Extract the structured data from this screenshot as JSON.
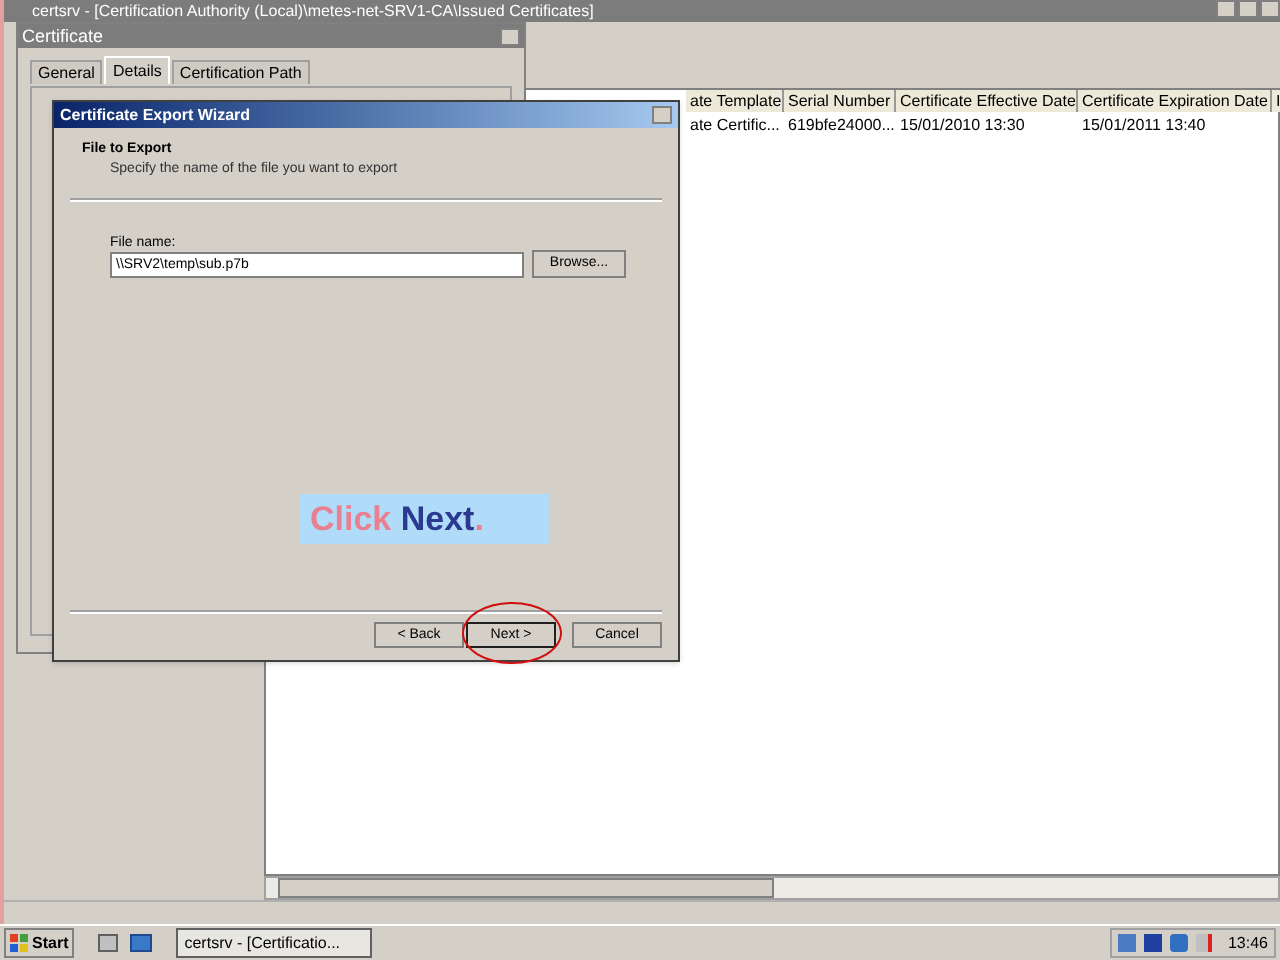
{
  "main_window": {
    "title": "certsrv - [Certification Authority (Local)\\metes-net-SRV1-CA\\Issued Certificates]",
    "columns": [
      "ate Template",
      "Serial Number",
      "Certificate Effective Date",
      "Certificate Expiration Date",
      "I"
    ],
    "rows": [
      {
        "cells": [
          "ate Certific...",
          "619bfe24000...",
          "15/01/2010 13:30",
          "15/01/2011 13:40",
          ""
        ]
      }
    ]
  },
  "certificate_dialog": {
    "title": "Certificate",
    "tabs": [
      {
        "label": "General",
        "selected": false
      },
      {
        "label": "Details",
        "selected": true
      },
      {
        "label": "Certification Path",
        "selected": false
      }
    ]
  },
  "wizard": {
    "title": "Certificate Export Wizard",
    "heading": "File to Export",
    "subheading": "Specify the name of the file you want to export",
    "file_label": "File name:",
    "file_value": "\\\\SRV2\\temp\\sub.p7b",
    "browse": "Browse...",
    "buttons": [
      {
        "label": "< Back",
        "highlighted": false
      },
      {
        "label": "Next >",
        "highlighted": true
      },
      {
        "label": "Cancel",
        "highlighted": false
      }
    ]
  },
  "callout": {
    "parts": [
      {
        "text": "Click",
        "color": "#e8808f"
      },
      {
        "text": "Next",
        "color": "#2b3990"
      },
      {
        "text": ".",
        "color": "#e8808f"
      }
    ]
  },
  "taskbar": {
    "start": "Start",
    "tasks": [
      "certsrv - [Certificatio..."
    ],
    "clock": "13:46"
  }
}
